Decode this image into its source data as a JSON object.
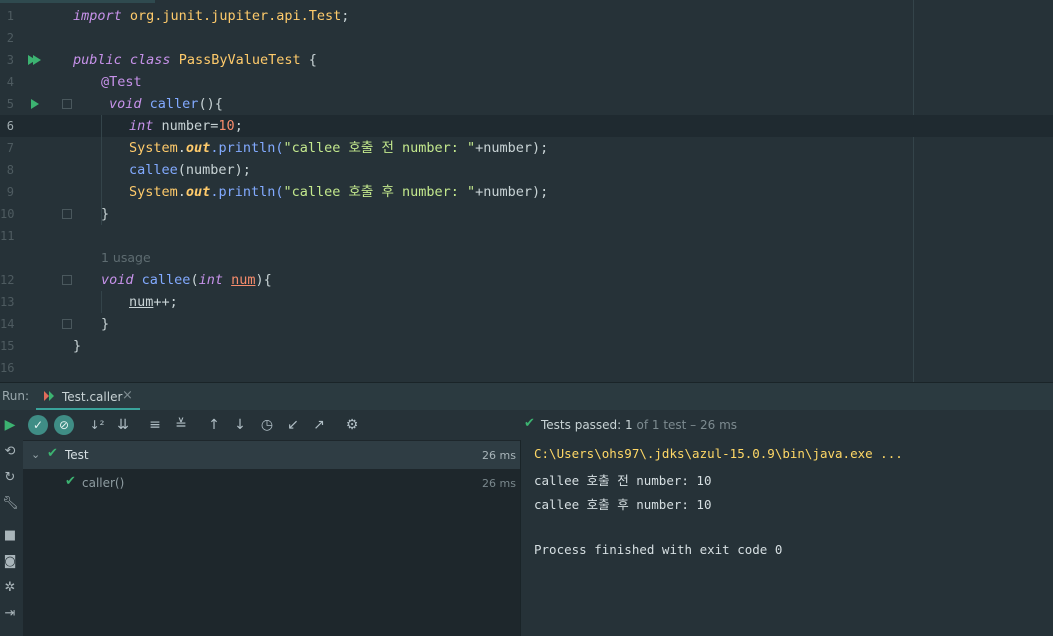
{
  "editor": {
    "line_numbers": [
      "1",
      "2",
      "3",
      "4",
      "5",
      "6",
      "7",
      "8",
      "9",
      "10",
      "11",
      "12",
      "13",
      "14",
      "15",
      "16"
    ],
    "code": {
      "l1": {
        "kw": "import",
        "pkg": " org.junit.jupiter.api.",
        "cls": "Test",
        "end": ";"
      },
      "l3": {
        "kw1": "public",
        "kw2": "class",
        "name": "PassByValueTest",
        "brace": " {"
      },
      "l4": {
        "anno": "@Test"
      },
      "l5": {
        "kw": "void",
        "fn": "caller",
        "end": "(){"
      },
      "l6": {
        "kw": "int",
        "var": " number=",
        "num": "10",
        "end": ";"
      },
      "l7": {
        "cls": "System",
        "dot": ".",
        "field": "out",
        "fn": ".println(",
        "str": "\"callee 호출 전 number: \"",
        "rest": "+number);"
      },
      "l8": {
        "fn": "callee",
        "rest": "(number);"
      },
      "l9": {
        "cls": "System",
        "dot": ".",
        "field": "out",
        "fn": ".println(",
        "str": "\"callee 호출 후 number: \"",
        "rest": "+number);"
      },
      "l10": {
        "brace": "}"
      },
      "usage": "1 usage",
      "l12": {
        "kw": "void",
        "fn": "callee",
        "open": "(",
        "kw2": "int",
        "param": "num",
        "end": "){"
      },
      "l13": {
        "param": "num",
        "rest": "++;"
      },
      "l14": {
        "brace": "}"
      },
      "l15": {
        "brace": "}"
      }
    },
    "current_line": 6
  },
  "run_panel": {
    "label": "Run:",
    "tab_label": "Test.caller",
    "tab_close": "×",
    "toolbar": {
      "rerun": "▶",
      "passed_toggle": "✓",
      "ignored_toggle": "⊘",
      "sort_alpha": "↓²",
      "sort_duration": "⇊",
      "expand_all": "≡",
      "collapse_all": "≚",
      "prev_failed": "↑",
      "next_failed": "↓",
      "history": "◷",
      "import_tests": "↙",
      "export_tests": "↗",
      "settings": "⚙"
    },
    "tree": [
      {
        "label": "Test",
        "time": "26 ms",
        "expanded": true
      },
      {
        "label": "caller()",
        "time": "26 ms"
      }
    ],
    "status": {
      "prefix": "Tests passed: ",
      "count": "1",
      "of": " of 1 test – 26 ms"
    },
    "console": [
      "C:\\Users\\ohs97\\.jdks\\azul-15.0.9\\bin\\java.exe ...",
      "callee 호출 전 number: 10",
      "callee 호출 후 number: 10",
      "",
      "Process finished with exit code 0"
    ]
  },
  "colors": {
    "accent": "#3aa39b",
    "pass_green": "#3cb371",
    "background": "#263238"
  }
}
